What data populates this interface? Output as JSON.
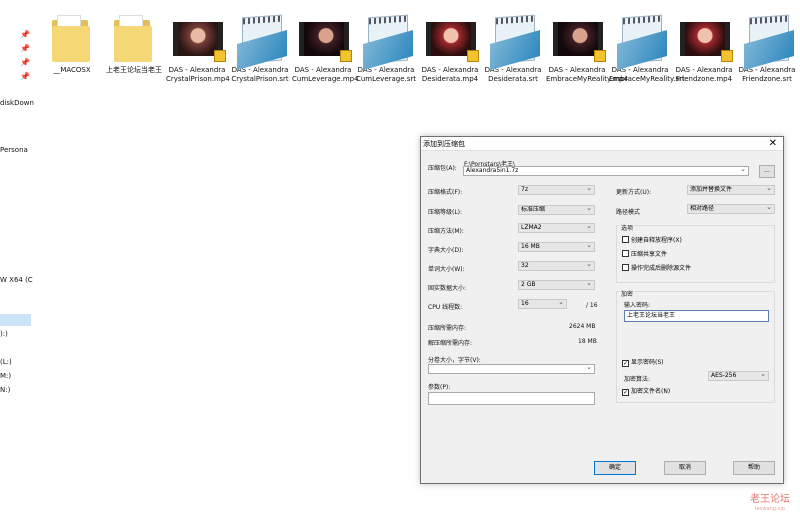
{
  "nav": {
    "items": [
      "diskDown",
      "Persona",
      "W X64 (C",
      "):)",
      "(L:)",
      "M:)",
      "N:)"
    ]
  },
  "files": [
    {
      "kind": "folder",
      "name": "__MACOSX"
    },
    {
      "kind": "folder",
      "name": "上老王论坛当老王"
    },
    {
      "kind": "video",
      "name": "DAS - Alexandra CrystalPrison.mp4"
    },
    {
      "kind": "text",
      "name": "DAS - Alexandra CrystalPrison.srt"
    },
    {
      "kind": "video",
      "name": "DAS - Alexandra CumLeverage.mp4"
    },
    {
      "kind": "text",
      "name": "DAS - Alexandra CumLeverage.srt"
    },
    {
      "kind": "video",
      "name": "DAS - Alexandra Desiderata.mp4"
    },
    {
      "kind": "text",
      "name": "DAS - Alexandra Desiderata.srt"
    },
    {
      "kind": "video",
      "name": "DAS - Alexandra EmbraceMyReality.mp4"
    },
    {
      "kind": "text",
      "name": "DAS - Alexandra EmbraceMyReality.srt"
    },
    {
      "kind": "video",
      "name": "DAS - Alexandra Friendzone.mp4"
    },
    {
      "kind": "text",
      "name": "DAS - Alexandra Friendzone.srt"
    }
  ],
  "dialog": {
    "title": "添加到压缩包",
    "close_glyph": "✕",
    "archive_label": "压缩包(A):",
    "archive_path": "F:\\Pornstars\\老王\\",
    "archive_name": "Alexandra5in1.7z",
    "browse_label": "...",
    "format_label": "压缩格式(F):",
    "format_value": "7z",
    "level_label": "压缩等级(L):",
    "level_value": "标准压缩",
    "method_label": "压缩方法(M):",
    "method_value": "LZMA2",
    "dict_label": "字典大小(D):",
    "dict_value": "16 MB",
    "word_label": "单词大小(W):",
    "word_value": "32",
    "solid_label": "固实数据大小:",
    "solid_value": "2 GB",
    "cpu_label": "CPU 线程数:",
    "cpu_value": "16",
    "cpu_total": "/ 16",
    "mem_comp_label": "压缩所需内存:",
    "mem_comp_value": "2624 MB",
    "mem_decomp_label": "解压缩所需内存:",
    "mem_decomp_value": "18 MB",
    "split_label": "分卷大小，字节(V):",
    "split_value": "",
    "params_label": "参数(P):",
    "params_value": "",
    "update_label": "更新方式(U):",
    "update_value": "添加并替换文件",
    "path_label": "路径模式",
    "path_value": "相对路径",
    "options_title": "选项",
    "opt_sfx": "创建自释放程序(X)",
    "opt_shared": "压缩共享文件",
    "opt_delete": "操作完成后删除源文件",
    "encrypt_title": "加密",
    "password_label": "输入密码:",
    "password_value": "上老王论坛当老王",
    "show_password": "显示密码(S)",
    "show_password_checked": "✓",
    "enc_method_label": "加密算法:",
    "enc_method_value": "AES-256",
    "encrypt_names": "加密文件名(N)",
    "encrypt_names_checked": "✓",
    "ok": "确定",
    "cancel": "取消",
    "help": "帮助"
  },
  "watermark": {
    "line1": "老王论坛",
    "line2": "laowang.vip"
  }
}
